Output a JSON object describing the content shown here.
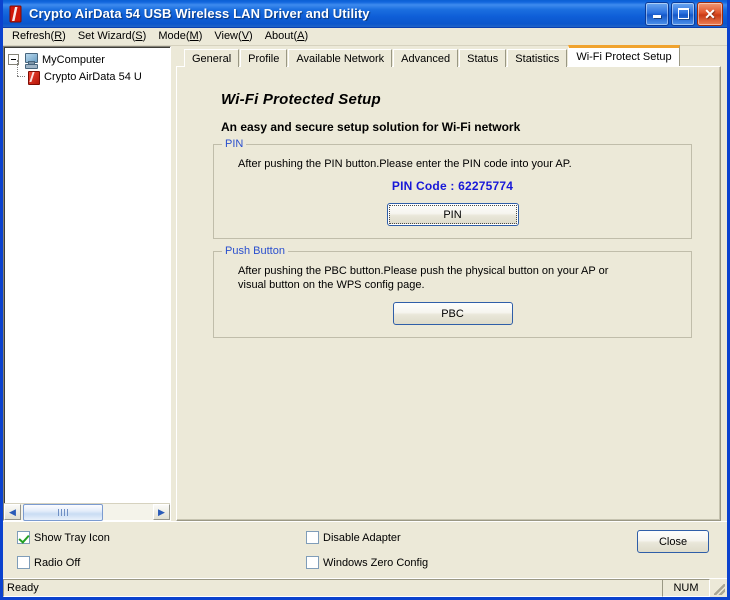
{
  "window": {
    "title": "Crypto AirData 54 USB Wireless LAN Driver and Utility",
    "icon": "adapter-icon",
    "minimize_label": "_",
    "maximize_label": "",
    "close_label": "✕"
  },
  "menubar": {
    "items": [
      {
        "text": "Refresh",
        "accel": "R"
      },
      {
        "text": "Set Wizard",
        "accel": "S"
      },
      {
        "text": "Mode",
        "accel": "M"
      },
      {
        "text": "View",
        "accel": "V"
      },
      {
        "text": "About",
        "accel": "A"
      }
    ]
  },
  "tree": {
    "root": {
      "label": "MyComputer",
      "expanded": true
    },
    "child": {
      "label": "Crypto AirData 54 U\u0015"
    },
    "scrollbar": {
      "left_arrow": "◀",
      "right_arrow": "▶"
    }
  },
  "tabs": [
    {
      "label": "General",
      "active": false
    },
    {
      "label": "Profile",
      "active": false
    },
    {
      "label": "Available Network",
      "active": false
    },
    {
      "label": "Advanced",
      "active": false
    },
    {
      "label": "Status",
      "active": false
    },
    {
      "label": "Statistics",
      "active": false
    },
    {
      "label": "Wi-Fi Protect Setup",
      "active": true
    }
  ],
  "wps": {
    "title": "Wi-Fi Protected Setup",
    "subtitle": "An easy and secure setup solution for Wi-Fi network",
    "pin_group": {
      "legend": "PIN",
      "description": "After pushing the PIN button.Please enter the PIN code into your AP.",
      "pin_code_label": "PIN Code :",
      "pin_code_value": "62275774",
      "pin_code_text": "PIN Code :  62275774",
      "button_label": "PIN"
    },
    "push_group": {
      "legend": "Push Button",
      "description": "After pushing the PBC button.Please push the physical button on your AP or visual button on the WPS config page.",
      "button_label": "PBC"
    }
  },
  "options": {
    "show_tray_icon": {
      "label": "Show Tray Icon",
      "checked": true
    },
    "radio_off": {
      "label": "Radio Off",
      "checked": false
    },
    "disable_adapter": {
      "label": "Disable Adapter",
      "checked": false
    },
    "windows_zero_config": {
      "label": "Windows Zero Config",
      "checked": false
    },
    "close_button": "Close"
  },
  "statusbar": {
    "message": "Ready",
    "num_indicator": "NUM"
  },
  "colors": {
    "titlebar_blue": "#0B56CC",
    "window_border": "#0B42CE",
    "face": "#ECE9D8",
    "legend_blue": "#2A4FCE",
    "pin_code_blue": "#1818D8",
    "active_tab_orange": "#F0A32E",
    "check_green": "#22A022"
  }
}
